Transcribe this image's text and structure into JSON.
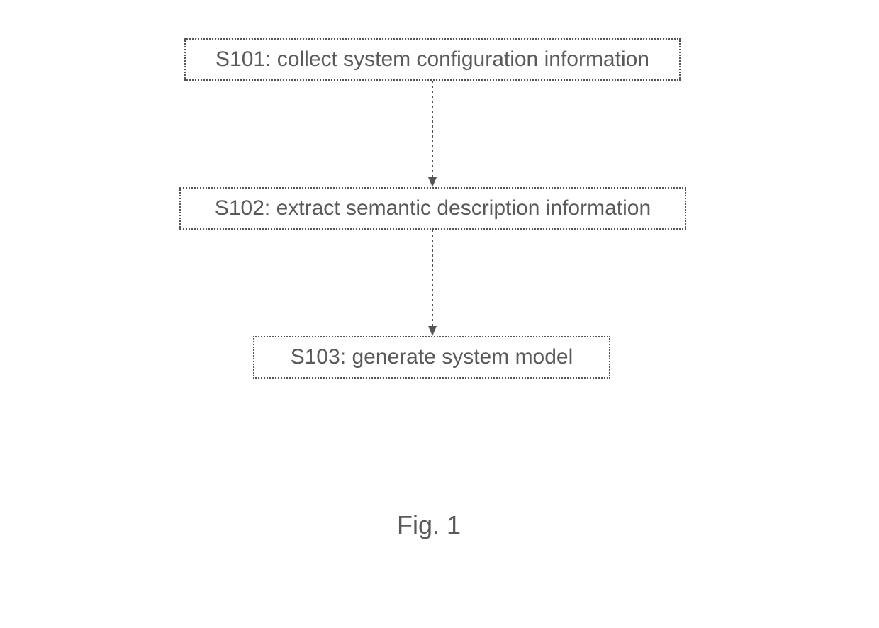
{
  "diagram": {
    "nodes": {
      "step1": "S101: collect system configuration information",
      "step2": "S102: extract semantic description information",
      "step3": "S103: generate system model"
    },
    "caption": "Fig. 1"
  }
}
